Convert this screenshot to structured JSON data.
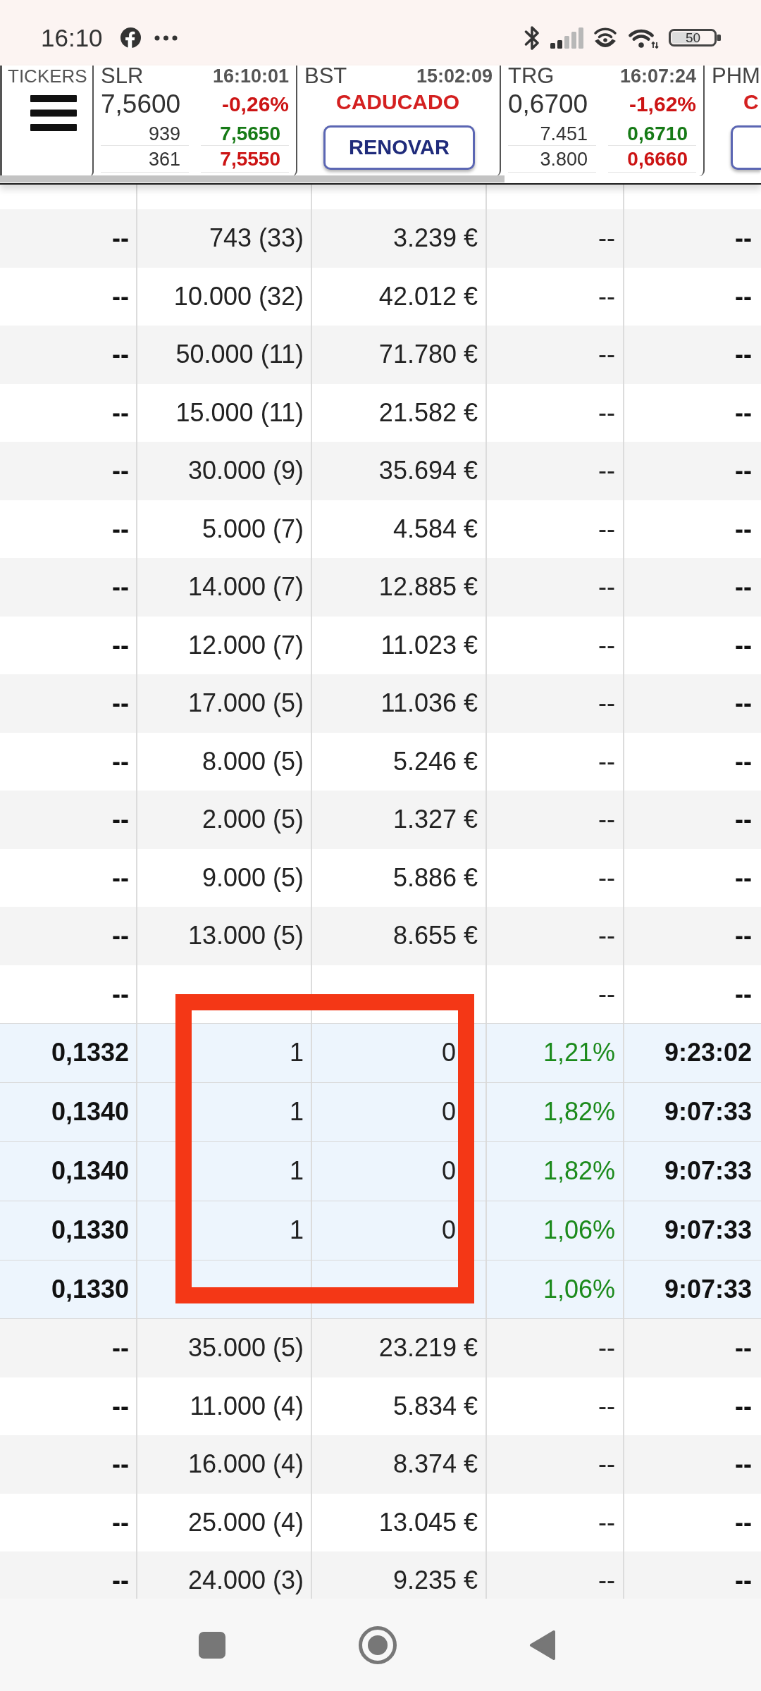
{
  "status_bar": {
    "time": "16:10",
    "battery": "50"
  },
  "ticker_bar": {
    "label": "TICKERS",
    "tickers": [
      {
        "kind": "quote",
        "symbol": "SLR",
        "time": "16:10:01",
        "price": "7,5600",
        "change": "-0,26%",
        "negative": true,
        "book": [
          {
            "size": "939",
            "price": "7,5650",
            "color": "#167a16"
          },
          {
            "size": "361",
            "price": "7,5550",
            "color": "#cc1414"
          }
        ]
      },
      {
        "kind": "expired",
        "symbol": "BST",
        "time": "15:02:09",
        "status": "CADUCADO",
        "button": "RENOVAR"
      },
      {
        "kind": "quote",
        "symbol": "TRG",
        "time": "16:07:24",
        "price": "0,6700",
        "change": "-1,62%",
        "negative": true,
        "book": [
          {
            "size": "7.451",
            "price": "0,6710",
            "color": "#167a16"
          },
          {
            "size": "3.800",
            "price": "0,6660",
            "color": "#cc1414"
          }
        ]
      },
      {
        "kind": "expired",
        "symbol": "PHM",
        "status": "C"
      }
    ]
  },
  "order_table": {
    "rows": [
      {
        "column_1": "--",
        "column_2": "743 (33)",
        "column_3": "3.239 €",
        "column_4": "--",
        "column_5": "--"
      },
      {
        "column_1": "--",
        "column_2": "10.000 (32)",
        "column_3": "42.012 €",
        "column_4": "--",
        "column_5": "--"
      },
      {
        "column_1": "--",
        "column_2": "50.000 (11)",
        "column_3": "71.780 €",
        "column_4": "--",
        "column_5": "--"
      },
      {
        "column_1": "--",
        "column_2": "15.000 (11)",
        "column_3": "21.582 €",
        "column_4": "--",
        "column_5": "--"
      },
      {
        "column_1": "--",
        "column_2": "30.000 (9)",
        "column_3": "35.694 €",
        "column_4": "--",
        "column_5": "--"
      },
      {
        "column_1": "--",
        "column_2": "5.000 (7)",
        "column_3": "4.584 €",
        "column_4": "--",
        "column_5": "--"
      },
      {
        "column_1": "--",
        "column_2": "14.000 (7)",
        "column_3": "12.885 €",
        "column_4": "--",
        "column_5": "--"
      },
      {
        "column_1": "--",
        "column_2": "12.000 (7)",
        "column_3": "11.023 €",
        "column_4": "--",
        "column_5": "--"
      },
      {
        "column_1": "--",
        "column_2": "17.000 (5)",
        "column_3": "11.036 €",
        "column_4": "--",
        "column_5": "--"
      },
      {
        "column_1": "--",
        "column_2": "8.000 (5)",
        "column_3": "5.246 €",
        "column_4": "--",
        "column_5": "--"
      },
      {
        "column_1": "--",
        "column_2": "2.000 (5)",
        "column_3": "1.327 €",
        "column_4": "--",
        "column_5": "--"
      },
      {
        "column_1": "--",
        "column_2": "9.000 (5)",
        "column_3": "5.886 €",
        "column_4": "--",
        "column_5": "--"
      },
      {
        "column_1": "--",
        "column_2": "13.000 (5)",
        "column_3": "8.655 €",
        "column_4": "--",
        "column_5": "--"
      },
      {
        "column_1": "--",
        "column_4": "--",
        "column_5": "--",
        "children": [
          {
            "column_1": "0,1332",
            "column_2": "1",
            "column_3": "0",
            "column_4": "1,21%",
            "negative": false,
            "column_5": "9:23:02"
          },
          {
            "column_1": "0,1340",
            "column_2": "1",
            "column_3": "0",
            "column_4": "1,82%",
            "negative": false,
            "column_5": "9:07:33"
          },
          {
            "column_1": "0,1340",
            "column_2": "1",
            "column_3": "0",
            "column_4": "1,82%",
            "negative": false,
            "column_5": "9:07:33"
          },
          {
            "column_1": "0,1330",
            "column_2": "1",
            "column_3": "0",
            "column_4": "1,06%",
            "negative": false,
            "column_5": "9:07:33"
          },
          {
            "column_1": "0,1330",
            "column_4": "1,06%",
            "negative": false,
            "column_5": "9:07:33"
          }
        ]
      },
      {
        "column_1": "--",
        "column_2": "35.000 (5)",
        "column_3": "23.219 €",
        "column_4": "--",
        "column_5": "--"
      },
      {
        "column_1": "--",
        "column_2": "11.000 (4)",
        "column_3": "5.834 €",
        "column_4": "--",
        "column_5": "--"
      },
      {
        "column_1": "--",
        "column_2": "16.000 (4)",
        "column_3": "8.374 €",
        "column_4": "--",
        "column_5": "--"
      },
      {
        "column_1": "--",
        "column_2": "25.000 (4)",
        "column_3": "13.045 €",
        "column_4": "--",
        "column_5": "--"
      },
      {
        "column_1": "--",
        "column_2": "24.000 (3)",
        "column_3": "9.235 €",
        "column_4": "--",
        "column_5": "--"
      }
    ]
  },
  "annotation": {
    "kind": "rectangle"
  }
}
